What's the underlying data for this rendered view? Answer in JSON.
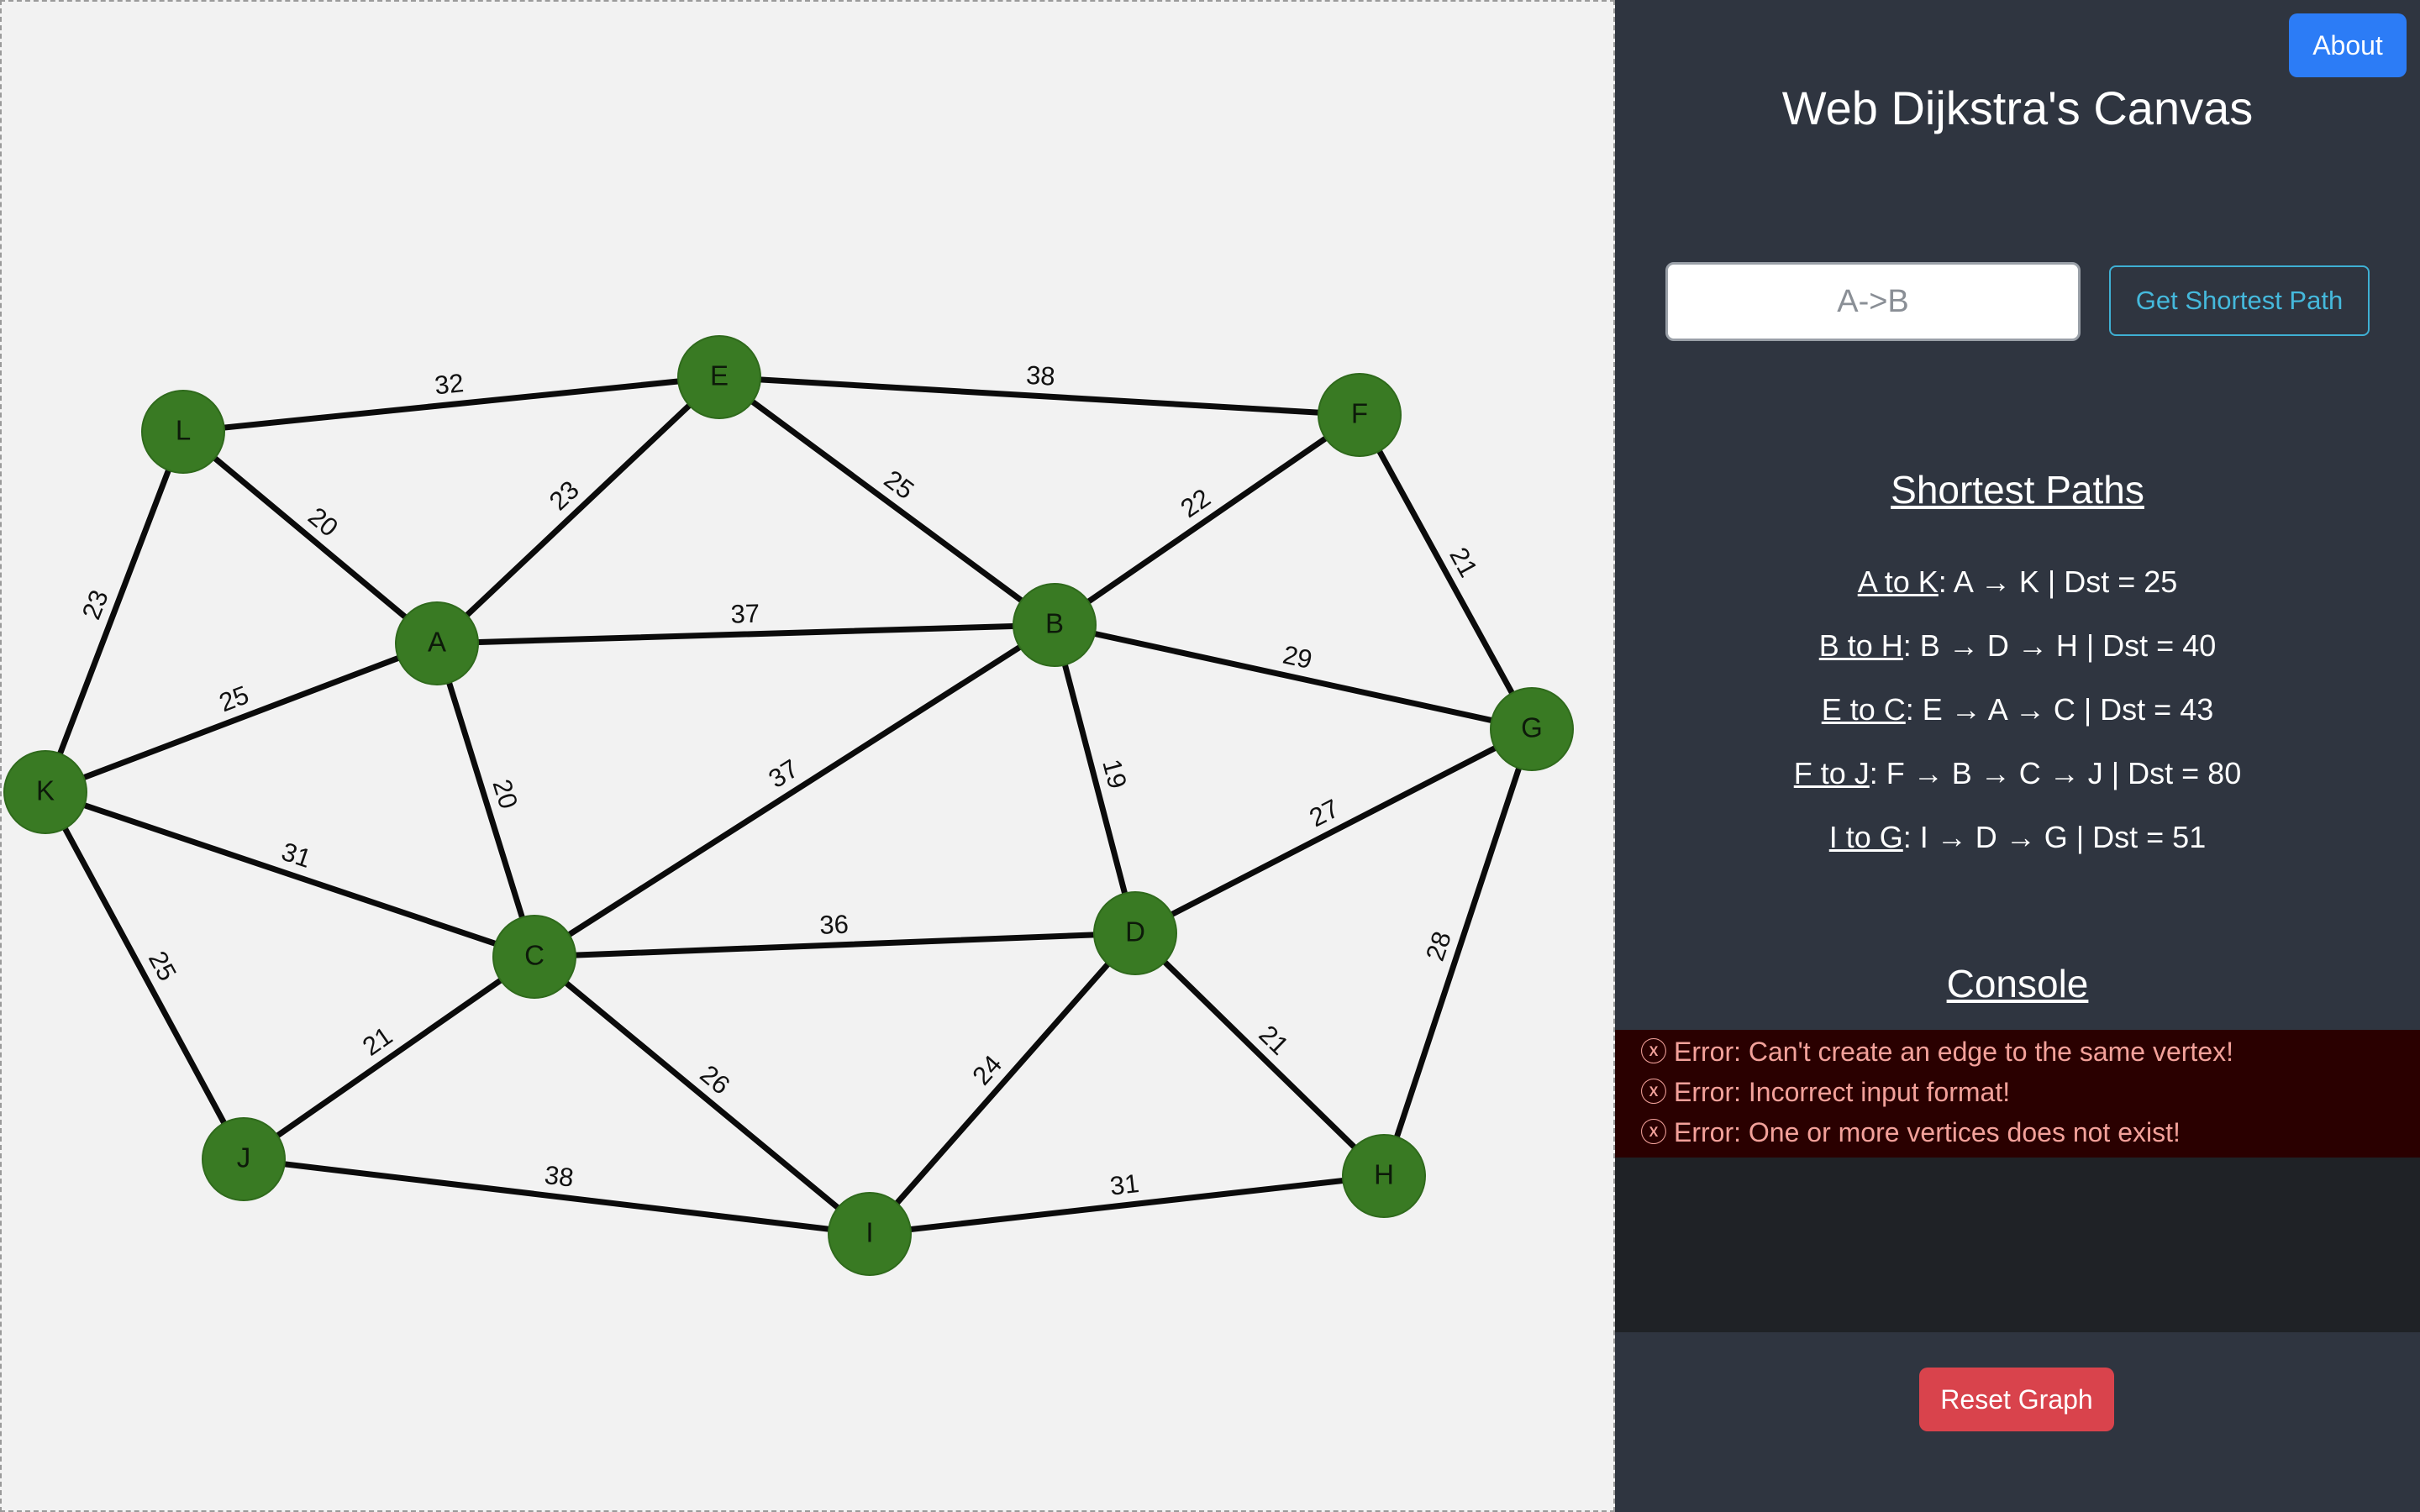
{
  "app": {
    "title": "Web Dijkstra's Canvas",
    "about_label": "About",
    "reset_label": "Reset Graph"
  },
  "search": {
    "placeholder": "A->B",
    "value": "",
    "button_label": "Get Shortest Path"
  },
  "shortest_paths": {
    "heading": "Shortest Paths",
    "items": [
      {
        "route": "A to K",
        "detail": ": A → K | Dst = 25"
      },
      {
        "route": "B to H",
        "detail": ": B → D → H | Dst = 40"
      },
      {
        "route": "E to C",
        "detail": ": E → A → C | Dst = 43"
      },
      {
        "route": "F to J",
        "detail": ": F → B → C → J | Dst = 80"
      },
      {
        "route": "I to G",
        "detail": ": I → D → G | Dst = 51"
      }
    ]
  },
  "console": {
    "heading": "Console",
    "error_icon": "circle-x-icon",
    "messages": [
      "Error: Can't create an edge to the same vertex!",
      "Error: Incorrect input format!",
      "Error: One or more vertices does not exist!"
    ]
  },
  "graph": {
    "colors": {
      "node_fill": "#397a23",
      "edge": "#0b0b0b",
      "canvas_bg": "#f2f2f2"
    },
    "nodes": [
      "A",
      "B",
      "C",
      "D",
      "E",
      "F",
      "G",
      "H",
      "I",
      "J",
      "K",
      "L"
    ],
    "edges": [
      {
        "from": "L",
        "to": "E",
        "weight": "32"
      },
      {
        "from": "E",
        "to": "F",
        "weight": "38"
      },
      {
        "from": "L",
        "to": "A",
        "weight": "20"
      },
      {
        "from": "A",
        "to": "E",
        "weight": "23"
      },
      {
        "from": "E",
        "to": "B",
        "weight": "25"
      },
      {
        "from": "B",
        "to": "F",
        "weight": "22"
      },
      {
        "from": "F",
        "to": "G",
        "weight": "21"
      },
      {
        "from": "L",
        "to": "K",
        "weight": "23"
      },
      {
        "from": "A",
        "to": "B",
        "weight": "37"
      },
      {
        "from": "B",
        "to": "G",
        "weight": "29"
      },
      {
        "from": "K",
        "to": "A",
        "weight": "25"
      },
      {
        "from": "A",
        "to": "C",
        "weight": "20"
      },
      {
        "from": "C",
        "to": "B",
        "weight": "37"
      },
      {
        "from": "B",
        "to": "D",
        "weight": "19"
      },
      {
        "from": "D",
        "to": "G",
        "weight": "27"
      },
      {
        "from": "K",
        "to": "C",
        "weight": "31"
      },
      {
        "from": "C",
        "to": "D",
        "weight": "36"
      },
      {
        "from": "K",
        "to": "J",
        "weight": "25"
      },
      {
        "from": "G",
        "to": "H",
        "weight": "28"
      },
      {
        "from": "J",
        "to": "C",
        "weight": "21"
      },
      {
        "from": "I",
        "to": "D",
        "weight": "24"
      },
      {
        "from": "D",
        "to": "H",
        "weight": "21"
      },
      {
        "from": "C",
        "to": "I",
        "weight": "26"
      },
      {
        "from": "J",
        "to": "I",
        "weight": "38"
      },
      {
        "from": "I",
        "to": "H",
        "weight": "31"
      }
    ]
  }
}
